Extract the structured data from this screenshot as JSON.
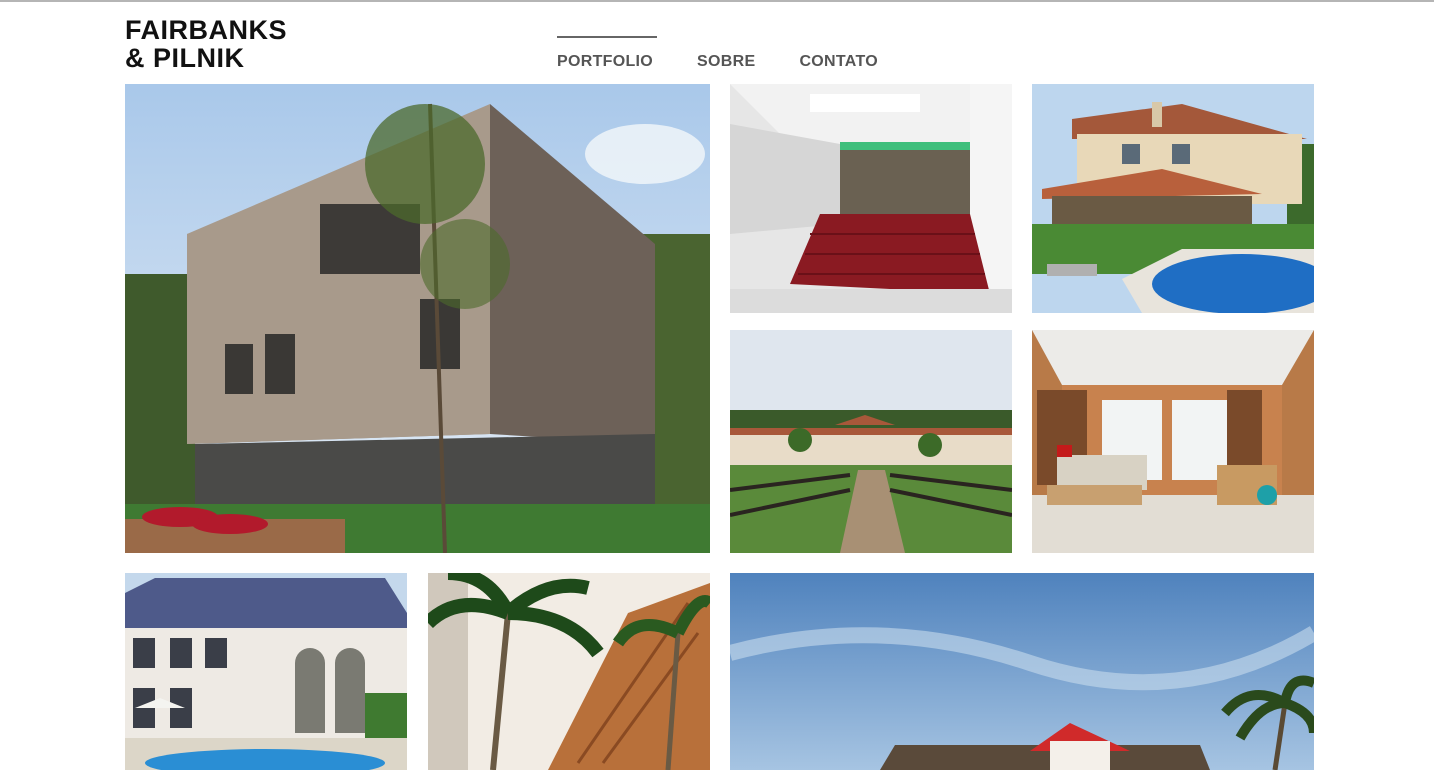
{
  "brand": {
    "line1": "FAIRBANKS",
    "line2": "& PILNIK"
  },
  "nav": {
    "items": [
      {
        "label": "PORTFOLIO",
        "active": true
      },
      {
        "label": "SOBRE",
        "active": false
      },
      {
        "label": "CONTATO",
        "active": false
      }
    ]
  },
  "colors": {
    "text": "#111111",
    "nav_text": "#555555",
    "divider": "#b5b5b5"
  }
}
